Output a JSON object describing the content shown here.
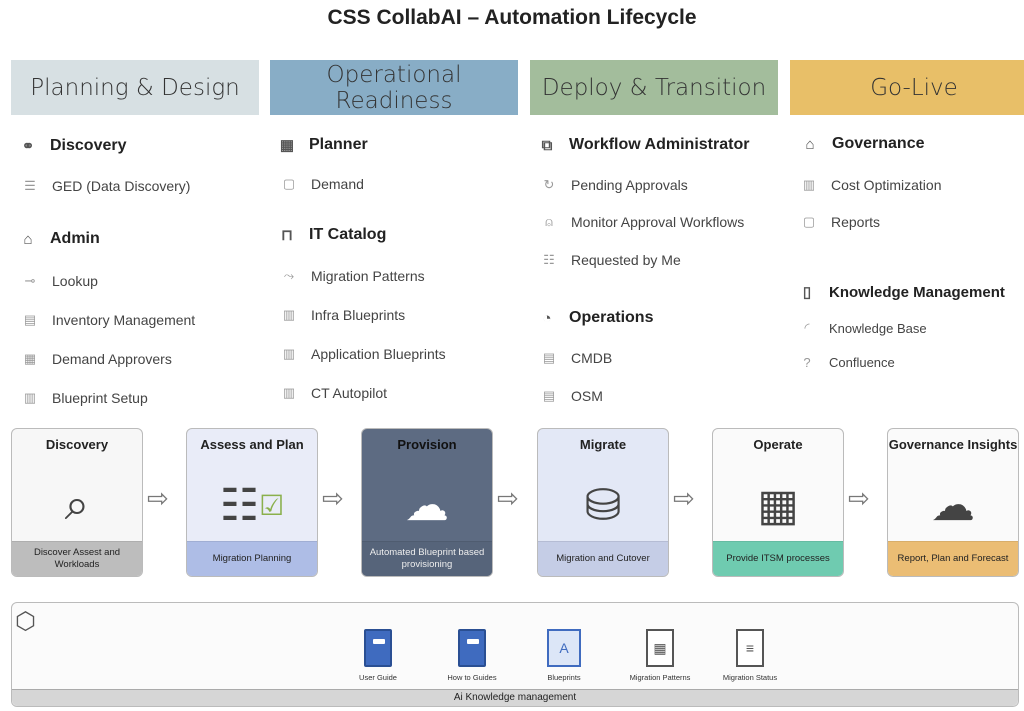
{
  "title": "CSS CollabAI – Automation Lifecycle",
  "colors": {
    "planning": "#d7e0e3",
    "operational": "#88adc6",
    "deploy": "#a3bd9c",
    "golive": "#e8bf68"
  },
  "phases": [
    {
      "label": "Planning & Design",
      "sections": [
        {
          "heading": "Discovery",
          "icon": "binoculars-icon",
          "items": [
            {
              "label": "GED (Data Discovery)",
              "icon": "database-icon"
            }
          ]
        },
        {
          "heading": "Admin",
          "icon": "graduation-cap-icon",
          "items": [
            {
              "label": "Lookup",
              "icon": "key-icon"
            },
            {
              "label": "Inventory Management",
              "icon": "inventory-icon"
            },
            {
              "label": "Demand Approvers",
              "icon": "approvers-icon"
            },
            {
              "label": "Blueprint Setup",
              "icon": "map-icon"
            }
          ]
        }
      ]
    },
    {
      "label": "Operational Readiness",
      "sections": [
        {
          "heading": "Planner",
          "icon": "calendar-icon",
          "items": [
            {
              "label": "Demand",
              "icon": "message-icon"
            }
          ]
        },
        {
          "heading": "IT Catalog",
          "icon": "bookmark-icon",
          "items": [
            {
              "label": "Migration Patterns",
              "icon": "pattern-icon"
            },
            {
              "label": "Infra Blueprints",
              "icon": "map-icon"
            },
            {
              "label": "Application Blueprints",
              "icon": "map-icon"
            },
            {
              "label": "CT Autopilot",
              "icon": "map-icon"
            }
          ]
        }
      ]
    },
    {
      "label": "Deploy & Transition",
      "sections": [
        {
          "heading": "Workflow Administrator",
          "icon": "workflow-icon",
          "items": [
            {
              "label": "Pending Approvals",
              "icon": "refresh-icon"
            },
            {
              "label": "Monitor Approval Workflows",
              "icon": "user-lock-icon"
            },
            {
              "label": "Requested by Me",
              "icon": "checklist-icon"
            }
          ]
        },
        {
          "heading": "Operations",
          "icon": "gauge-icon",
          "items": [
            {
              "label": "CMDB",
              "icon": "document-icon"
            },
            {
              "label": "OSM",
              "icon": "document-search-icon"
            }
          ]
        }
      ]
    },
    {
      "label": "Go-Live",
      "sections": [
        {
          "heading": "Governance",
          "icon": "graduation-cap-icon",
          "items": [
            {
              "label": "Cost Optimization",
              "icon": "chart-icon"
            },
            {
              "label": "Reports",
              "icon": "report-icon"
            }
          ]
        },
        {
          "heading": "Knowledge Management",
          "icon": "book-icon",
          "items": [
            {
              "label": "Knowledge Base",
              "icon": "signal-icon"
            },
            {
              "label": "Confluence",
              "icon": "help-icon"
            }
          ]
        }
      ]
    }
  ],
  "stages": [
    {
      "title": "Discovery",
      "footer": "Discover Assest and Workloads",
      "icon": "compass-database-icon"
    },
    {
      "title": "Assess and Plan",
      "footer": "Migration Planning",
      "icon": "database-checklist-icon"
    },
    {
      "title": "Provision",
      "footer": "Automated Blueprint based provisioning",
      "icon": "cloud-gears-icon"
    },
    {
      "title": "Migrate",
      "footer": "Migration and Cutover",
      "icon": "migration-icon"
    },
    {
      "title": "Operate",
      "footer": "Provide ITSM processes",
      "icon": "dashboard-icon"
    },
    {
      "title": "Governance Insights",
      "footer": "Report, Plan and Forecast",
      "icon": "cloud-dollar-icon"
    }
  ],
  "knowledge": {
    "label": "Ai Knowledge management",
    "items": [
      "User Guide",
      "How to Guides",
      "Blueprints",
      "Migration Patterns",
      "Migration Status"
    ]
  }
}
